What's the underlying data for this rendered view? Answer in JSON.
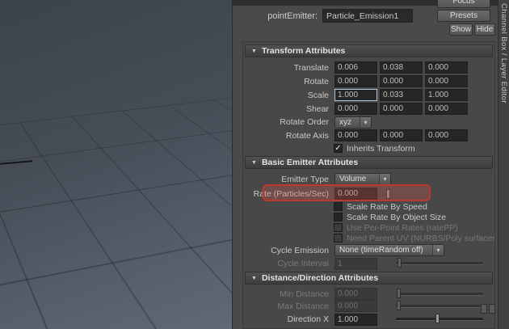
{
  "colors": {
    "annotation_red": "#c4362a",
    "panel_bg": "#4a4a4a",
    "field_bg": "#262626",
    "focus_border": "#a9c5e0"
  },
  "icons": {
    "collapse_arrow": "▼",
    "dropdown_arrow": "▾",
    "check": "✓"
  },
  "header": {
    "label": "pointEmitter:",
    "name_value": "Particle_Emission1",
    "focus_button": "Focus",
    "presets_button": "Presets",
    "show_button": "Show",
    "hide_button": "Hide"
  },
  "side_tab": {
    "label": "Channel Box / Layer Editor"
  },
  "transform_section": {
    "title": "Transform Attributes",
    "rows": [
      {
        "label": "Translate",
        "values": [
          "0.006",
          "0.038",
          "0.000"
        ]
      },
      {
        "label": "Rotate",
        "values": [
          "0.000",
          "0.000",
          "0.000"
        ]
      },
      {
        "label": "Scale",
        "values": [
          "1.000",
          "0.033",
          "1.000"
        ]
      },
      {
        "label": "Shear",
        "values": [
          "0.000",
          "0.000",
          "0.000"
        ]
      }
    ],
    "rotate_order": {
      "label": "Rotate Order",
      "value": "xyz"
    },
    "rotate_axis": {
      "label": "Rotate Axis",
      "values": [
        "0.000",
        "0.000",
        "0.000"
      ]
    },
    "inherits_transform": {
      "label": "Inherits Transform",
      "checked": true
    }
  },
  "emitter_section": {
    "title": "Basic Emitter Attributes",
    "emitter_type": {
      "label": "Emitter Type",
      "value": "Volume"
    },
    "rate": {
      "label": "Rate (Particles/Sec)",
      "value": "0.000",
      "highlighted": true
    },
    "options": [
      {
        "label": "Scale Rate By Speed",
        "checked": false,
        "enabled": true
      },
      {
        "label": "Scale Rate By Object Size",
        "checked": false,
        "enabled": true
      },
      {
        "label": "Use Per-Point Rates (ratePP)",
        "checked": false,
        "enabled": false
      },
      {
        "label": "Need Parent UV (NURBS/Poly surfaces only)",
        "checked": false,
        "enabled": false
      }
    ],
    "cycle_emission": {
      "label": "Cycle Emission",
      "value": "None (timeRandom off)"
    },
    "cycle_interval": {
      "label": "Cycle Interval",
      "value": "1",
      "enabled": false
    }
  },
  "distance_section": {
    "title": "Distance/Direction Attributes",
    "min_distance": {
      "label": "Min Distance",
      "value": "0.000",
      "enabled": false
    },
    "max_distance": {
      "label": "Max Distance",
      "value": "0.000",
      "enabled": false
    },
    "direction_x": {
      "label": "Direction X",
      "value": "1.000",
      "enabled": true
    }
  }
}
